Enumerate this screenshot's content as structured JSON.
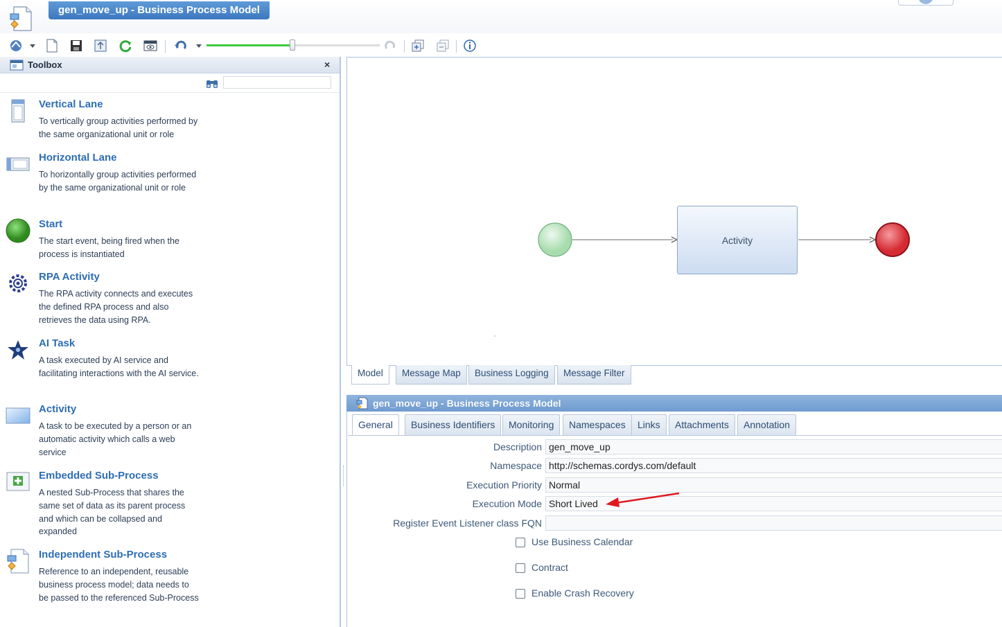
{
  "header": {
    "title": "gen_move_up - Business Process Model"
  },
  "toolbar": {
    "icons": [
      "process-icon",
      "new-icon",
      "save-icon",
      "publish-icon",
      "refresh-icon",
      "preview-icon",
      "undo-icon",
      "redo-icon",
      "group-icon",
      "ungroup-icon",
      "info-icon"
    ],
    "zoom_level": 0.5
  },
  "toolbox": {
    "title": "Toolbox",
    "close": "×",
    "search_placeholder": "",
    "items": [
      {
        "title": "Vertical Lane",
        "description": "To vertically group activities performed by the same organizational unit or role"
      },
      {
        "title": "Horizontal Lane",
        "description": "To horizontally group activities performed by the same organizational unit or role"
      },
      {
        "title": "Start",
        "description": "The start event, being fired when the process is instantiated"
      },
      {
        "title": "RPA Activity",
        "description": "The RPA activity connects and executes the defined RPA process and also retrieves the data using RPA."
      },
      {
        "title": "AI Task",
        "description": "A task executed by AI service and facilitating interactions with the AI service."
      },
      {
        "title": "Activity",
        "description": "A task to be executed by a person or an automatic activity which calls a web service"
      },
      {
        "title": "Embedded Sub-Process",
        "description": "A nested Sub-Process that shares the same set of data as its parent process and which can be collapsed and expanded"
      },
      {
        "title": "Independent Sub-Process",
        "description": "Reference to an independent, reusable business process model; data needs to be passed to the referenced Sub-Process"
      }
    ]
  },
  "canvas": {
    "activity_label": "Activity",
    "start_color": "#cdeccf",
    "end_color": "#e8434a"
  },
  "bottom_tabs": [
    "Model",
    "Message Map",
    "Business Logging",
    "Message Filter"
  ],
  "properties": {
    "title": "gen_move_up - Business Process Model",
    "tabs": [
      "General",
      "Business Identifiers",
      "Monitoring",
      "Namespaces",
      "Links",
      "Attachments",
      "Annotation"
    ],
    "fields": {
      "description_label": "Description",
      "description_value": "gen_move_up",
      "namespace_label": "Namespace",
      "namespace_value": "http://schemas.cordys.com/default",
      "priority_label": "Execution Priority",
      "priority_value": "Normal",
      "mode_label": "Execution Mode",
      "mode_value": "Short Lived",
      "listener_label": "Register Event Listener class FQN",
      "listener_value": ""
    },
    "checkboxes": {
      "business_calendar": "Use Business Calendar",
      "contract": "Contract",
      "crash_recovery": "Enable Crash Recovery"
    },
    "annotation_arrow_color": "#e0191f"
  }
}
